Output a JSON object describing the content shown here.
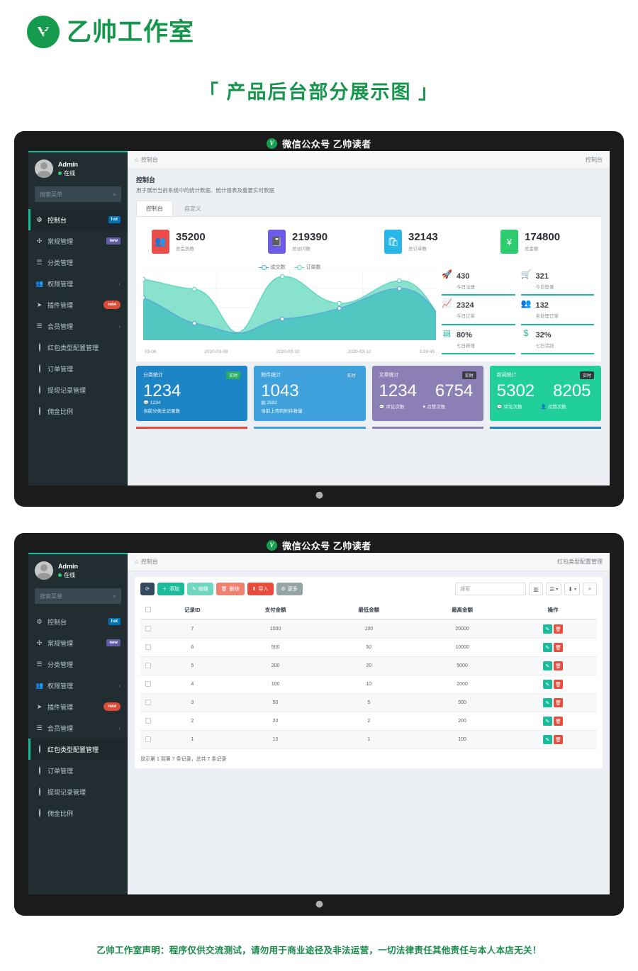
{
  "brand": {
    "mark": "logo-icon",
    "name": "乙帅工作室"
  },
  "page_title": "「 产品后台部分展示图 」",
  "disclaimer": "乙帅工作室声明：程序仅供交流测试，请勿用于商业途径及非法运营，一切法律责任其他责任与本人本店无关！",
  "window_title": "微信公众号  乙帅读者",
  "sidebar": {
    "user": {
      "name": "Admin",
      "status": "在线"
    },
    "search_placeholder": "搜索菜单",
    "items": [
      {
        "label": "控制台",
        "icon": "dashboard-icon",
        "badge": "hot",
        "badge_type": "hot"
      },
      {
        "label": "常规管理",
        "icon": "gears-icon",
        "badge": "new",
        "badge_type": "newp"
      },
      {
        "label": "分类管理",
        "icon": "list-icon",
        "badge": "",
        "badge_type": ""
      },
      {
        "label": "权限管理",
        "icon": "users-icon",
        "badge": "",
        "badge_type": "",
        "caret": "‹"
      },
      {
        "label": "插件管理",
        "icon": "paper-plane-icon",
        "badge": "new",
        "badge_type": "newr"
      },
      {
        "label": "会员管理",
        "icon": "list-icon",
        "badge": "",
        "badge_type": "",
        "caret": "‹"
      },
      {
        "label": "红包类型配置管理",
        "icon": "circle-icon",
        "badge": "",
        "badge_type": ""
      },
      {
        "label": "订单管理",
        "icon": "circle-icon",
        "badge": "",
        "badge_type": ""
      },
      {
        "label": "提现记录管理",
        "icon": "circle-icon",
        "badge": "",
        "badge_type": ""
      },
      {
        "label": "佣金比例",
        "icon": "circle-icon",
        "badge": "",
        "badge_type": ""
      }
    ]
  },
  "dashboard": {
    "breadcrumb_left": "控制台",
    "breadcrumb_right": "控制台",
    "heading": "控制台",
    "subheading": "用于展示当前系统中的统计数据、统计报表及重要实时数据",
    "tabs": [
      {
        "label": "控制台",
        "active": true
      },
      {
        "label": "自定义",
        "active": false
      }
    ],
    "tiles": [
      {
        "value": "35200",
        "label": "总会员数",
        "icon": "users-icon",
        "color": "#eb4d4b"
      },
      {
        "value": "219390",
        "label": "总访问数",
        "icon": "book-icon",
        "color": "#6c5ce7"
      },
      {
        "value": "32143",
        "label": "总订单数",
        "icon": "bag-icon",
        "color": "#29b6e8"
      },
      {
        "value": "174800",
        "label": "总金额",
        "icon": "yen-icon",
        "color": "#2ecc71"
      }
    ],
    "mini_stats": [
      {
        "value": "430",
        "label": "今日注册",
        "icon": "rocket-icon"
      },
      {
        "value": "321",
        "label": "今日登录",
        "icon": "cart-icon"
      },
      {
        "value": "2324",
        "label": "今日订单",
        "icon": "chart-line-icon"
      },
      {
        "value": "132",
        "label": "未处理订单",
        "icon": "users-icon"
      },
      {
        "value": "80%",
        "label": "七日新增",
        "icon": "list-alt-icon"
      },
      {
        "value": "32%",
        "label": "七日活跃",
        "icon": "dollar-icon"
      }
    ],
    "cards": [
      {
        "title": "分类统计",
        "badge": "实时",
        "badge_bg": "#27ae60",
        "bg": "#1d84c6",
        "values": [
          "1234"
        ],
        "subs": [
          "1234"
        ],
        "sub_icons": [
          "comment-icon"
        ],
        "foot": "当前分类总记录数"
      },
      {
        "title": "附件统计",
        "badge": "实时",
        "badge_bg": "#3f9ed4",
        "bg": "#3fa2dd",
        "values": [
          "1043"
        ],
        "subs": [
          "2592"
        ],
        "sub_icons": [
          "layers-icon"
        ],
        "foot": "当前上传的附件数量"
      },
      {
        "title": "文章统计",
        "badge": "实时",
        "badge_bg": "#3b3a4a",
        "bg": "#8b7fb5",
        "values": [
          "1234",
          "6754"
        ],
        "subs": [
          "评论次数",
          "点赞次数"
        ],
        "sub_icons": [
          "comment-icon",
          "heart-icon"
        ],
        "foot": ""
      },
      {
        "title": "新闻统计",
        "badge": "实时",
        "badge_bg": "#2b3a38",
        "bg": "#21cf9b",
        "values": [
          "5302",
          "8205"
        ],
        "subs": [
          "评论次数",
          "点赞次数"
        ],
        "sub_icons": [
          "comment-icon",
          "user-icon"
        ],
        "foot": ""
      }
    ]
  },
  "chart_data": {
    "type": "area",
    "title": "",
    "legend": [
      {
        "name": "成交数",
        "color": "#4aa8d8"
      },
      {
        "name": "订单数",
        "color": "#5fd8bd"
      }
    ],
    "legend_position": "top-center",
    "x": [
      "03-06",
      "2020-03-08",
      "2020-03-10",
      "2020-03-12",
      "3:09:45"
    ],
    "xlabel": "",
    "ylabel": "",
    "grid": true,
    "ylim": [
      0,
      100
    ],
    "series": [
      {
        "name": "成交数",
        "color": "#4aa8d8",
        "values": [
          62,
          28,
          18,
          35,
          30,
          46,
          78,
          76,
          40
        ]
      },
      {
        "name": "订单数",
        "color": "#5fd8bd",
        "values": [
          86,
          74,
          18,
          96,
          72,
          65,
          90,
          78,
          40
        ]
      }
    ]
  },
  "table_page": {
    "breadcrumb_left": "控制台",
    "breadcrumb_right": "红包类型配置管理",
    "toolbar": {
      "refresh": "",
      "buttons": [
        {
          "label": "添加",
          "icon": "plus-icon",
          "style": "green"
        },
        {
          "label": "编辑",
          "icon": "pencil-icon",
          "style": "lgreen"
        },
        {
          "label": "删除",
          "icon": "trash-icon",
          "style": "salmon"
        },
        {
          "label": "导入",
          "icon": "upload-icon",
          "style": "red"
        },
        {
          "label": "更多",
          "icon": "gear-icon",
          "style": "grey"
        }
      ],
      "search_placeholder": "搜索",
      "icon_buttons": [
        "columns-icon",
        "list-toggle-icon",
        "export-icon",
        "search-icon"
      ]
    },
    "columns": [
      "",
      "记录ID",
      "支付金额",
      "最低金额",
      "最高金额",
      "操作"
    ],
    "rows": [
      {
        "id": "7",
        "pay": "1000",
        "min": "100",
        "max": "20000"
      },
      {
        "id": "6",
        "pay": "500",
        "min": "50",
        "max": "10000"
      },
      {
        "id": "5",
        "pay": "200",
        "min": "20",
        "max": "5000"
      },
      {
        "id": "4",
        "pay": "100",
        "min": "10",
        "max": "2000"
      },
      {
        "id": "3",
        "pay": "50",
        "min": "5",
        "max": "500"
      },
      {
        "id": "2",
        "pay": "20",
        "min": "2",
        "max": "200"
      },
      {
        "id": "1",
        "pay": "10",
        "min": "1",
        "max": "100"
      }
    ],
    "info": "显示第 1 到第 7 条记录，总共 7 条记录",
    "row_action_edit": "✎",
    "row_action_delete": "🗑"
  }
}
